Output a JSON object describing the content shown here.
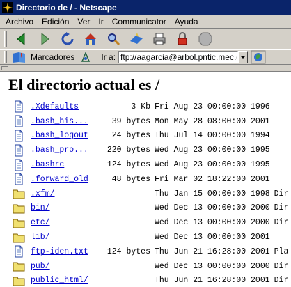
{
  "window": {
    "title": "Directorio de / - Netscape"
  },
  "menu": [
    "Archivo",
    "Edición",
    "Ver",
    "Ir",
    "Communicator",
    "Ayuda"
  ],
  "toolbar": {
    "buttons": [
      "back-icon",
      "forward-icon",
      "reload-icon",
      "home-icon",
      "search-icon",
      "guide-icon",
      "print-icon",
      "security-icon",
      "stop-icon"
    ]
  },
  "location": {
    "bookmarks_label": "Marcadores",
    "go_label": "Ir a:",
    "url": "ftp://aagarcia@arbol.pntic.mec.es/"
  },
  "page": {
    "heading": "El directorio actual es /"
  },
  "files": [
    {
      "name": ".Xdefaults",
      "size": "3 Kb",
      "date": "Fri Aug 23 00:00:00 1996",
      "type": "",
      "icon": "file-icon"
    },
    {
      "name": ".bash_his...",
      "size": "39 bytes",
      "date": "Mon May 28 08:00:00 2001",
      "type": "",
      "icon": "file-icon"
    },
    {
      "name": ".bash_logout",
      "size": "24 bytes",
      "date": "Thu Jul 14 00:00:00 1994",
      "type": "",
      "icon": "file-icon"
    },
    {
      "name": ".bash_pro...",
      "size": "220 bytes",
      "date": "Wed Aug 23 00:00:00 1995",
      "type": "",
      "icon": "file-icon"
    },
    {
      "name": ".bashrc",
      "size": "124 bytes",
      "date": "Wed Aug 23 00:00:00 1995",
      "type": "",
      "icon": "file-icon"
    },
    {
      "name": ".forward_old",
      "size": "48 bytes",
      "date": "Fri Mar 02 18:22:00 2001",
      "type": "",
      "icon": "file-icon"
    },
    {
      "name": ".xfm/",
      "size": "",
      "date": "Thu Jan 15 00:00:00 1998",
      "type": "Dir",
      "icon": "folder-icon"
    },
    {
      "name": "bin/",
      "size": "",
      "date": "Wed Dec 13 00:00:00 2000",
      "type": "Dir",
      "icon": "folder-icon"
    },
    {
      "name": "etc/",
      "size": "",
      "date": "Wed Dec 13 00:00:00 2000",
      "type": "Dir",
      "icon": "folder-icon"
    },
    {
      "name": "lib/",
      "size": "",
      "date": "Wed Dec 13 00:00:00 2001",
      "type": "",
      "icon": "folder-icon"
    },
    {
      "name": "ftp-iden.txt",
      "size": "124 bytes",
      "date": "Thu Jun 21 16:28:00 2001",
      "type": "Pla",
      "icon": "file-icon"
    },
    {
      "name": "pub/",
      "size": "",
      "date": "Wed Dec 13 00:00:00 2000",
      "type": "Dir",
      "icon": "folder-icon"
    },
    {
      "name": "public_html/",
      "size": "",
      "date": "Thu Jun 21 16:28:00 2001",
      "type": "Dir",
      "icon": "folder-icon"
    }
  ]
}
